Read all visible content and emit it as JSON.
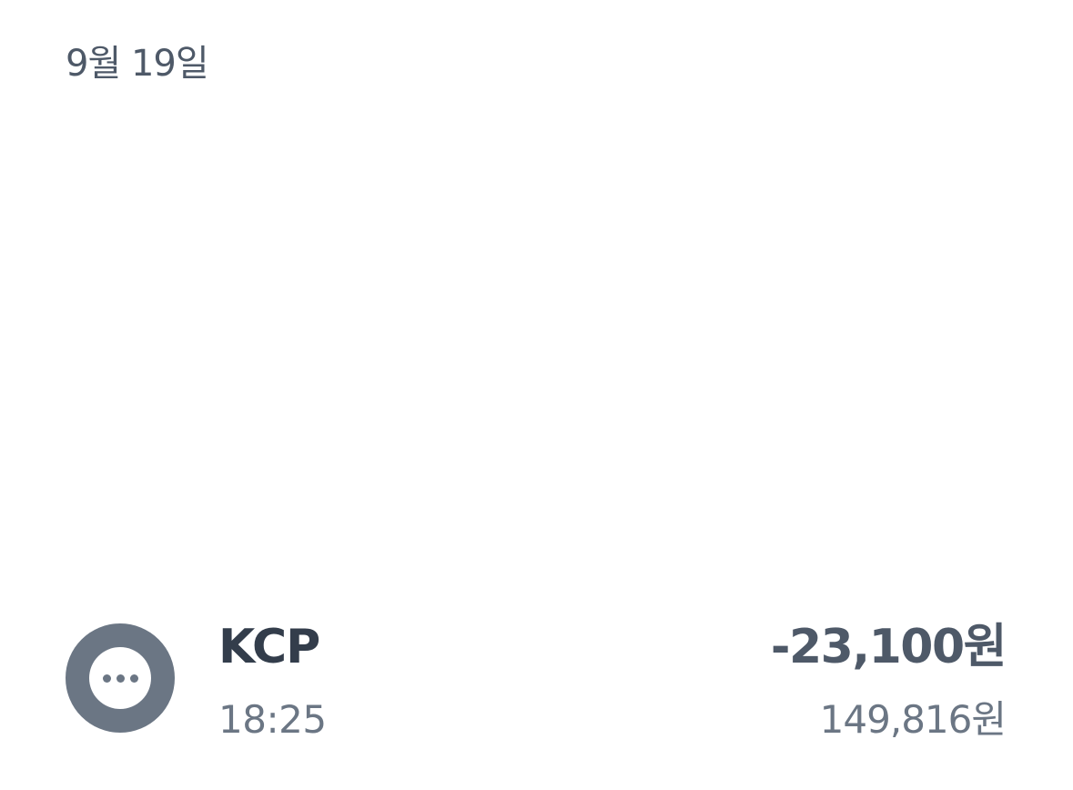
{
  "date_header": "9월 19일",
  "transaction": {
    "icon": "more-dots-icon",
    "merchant": "KCP",
    "time": "18:25",
    "amount": "-23,100원",
    "balance": "149,816원"
  },
  "colors": {
    "avatar_background": "#6b7684",
    "primary_text": "#333d4b",
    "secondary_text": "#6b7684",
    "amount_text": "#4e5968"
  }
}
